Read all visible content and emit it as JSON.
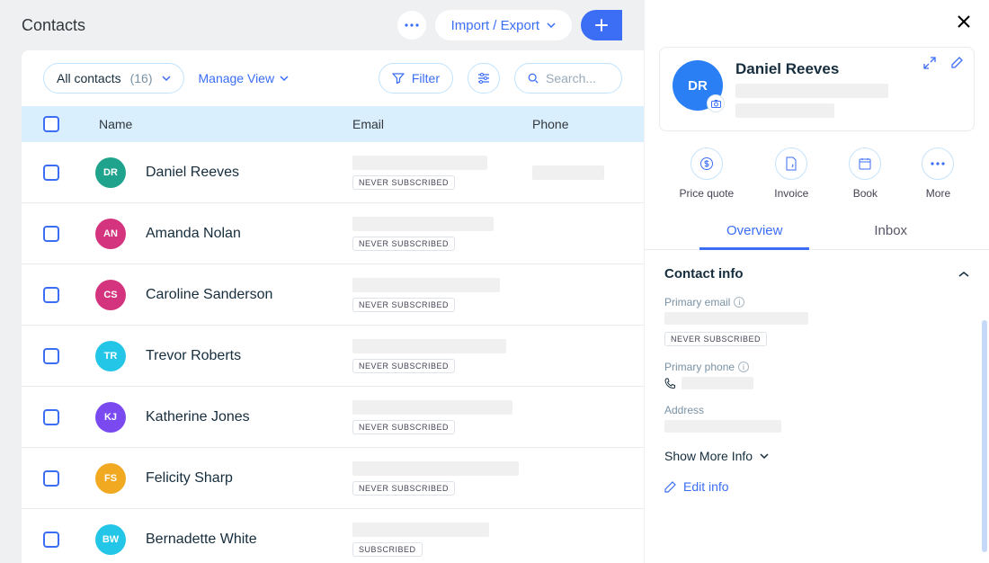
{
  "header": {
    "title": "Contacts",
    "import_export": "Import / Export"
  },
  "filters": {
    "view_label": "All contacts",
    "view_count": "(16)",
    "manage_view": "Manage View",
    "filter": "Filter",
    "search_placeholder": "Search..."
  },
  "columns": {
    "name": "Name",
    "email": "Email",
    "phone": "Phone"
  },
  "badges": {
    "never": "NEVER SUBSCRIBED",
    "subscribed": "SUBSCRIBED"
  },
  "rows": [
    {
      "initials": "DR",
      "name": "Daniel Reeves",
      "color": "#1fa38c",
      "badge": "never"
    },
    {
      "initials": "AN",
      "name": "Amanda Nolan",
      "color": "#d4337e",
      "badge": "never"
    },
    {
      "initials": "CS",
      "name": "Caroline Sanderson",
      "color": "#d4337e",
      "badge": "never"
    },
    {
      "initials": "TR",
      "name": "Trevor Roberts",
      "color": "#23c6e6",
      "badge": "never"
    },
    {
      "initials": "KJ",
      "name": "Katherine Jones",
      "color": "#7a4af0",
      "badge": "never"
    },
    {
      "initials": "FS",
      "name": "Felicity Sharp",
      "color": "#f0a920",
      "badge": "never"
    },
    {
      "initials": "BW",
      "name": "Bernadette White",
      "color": "#23c6e6",
      "badge": "subscribed"
    }
  ],
  "detail": {
    "initials": "DR",
    "name": "Daniel Reeves",
    "quick": {
      "price_quote": "Price quote",
      "invoice": "Invoice",
      "book": "Book",
      "more": "More"
    },
    "tabs": {
      "overview": "Overview",
      "inbox": "Inbox"
    },
    "section_title": "Contact info",
    "primary_email": "Primary email",
    "never_subscribed": "NEVER SUBSCRIBED",
    "primary_phone": "Primary phone",
    "address": "Address",
    "show_more": "Show More Info",
    "edit": "Edit info"
  }
}
